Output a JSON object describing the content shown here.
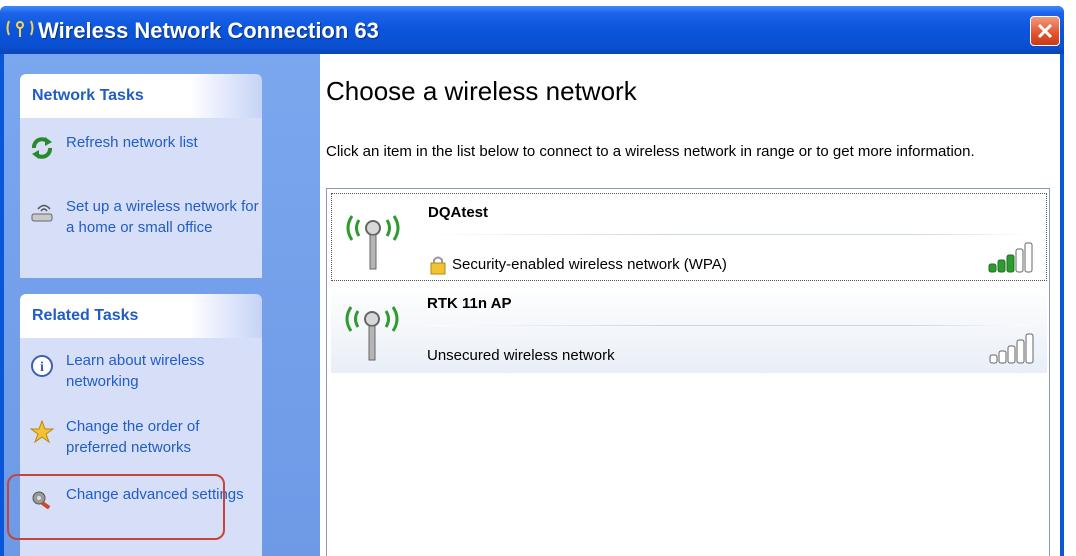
{
  "window": {
    "title": "Wireless Network Connection 63"
  },
  "left_pane": {
    "network_tasks": {
      "header": "Network Tasks",
      "items": [
        {
          "label": "Refresh network list",
          "icon": "refresh-icon"
        },
        {
          "label": "Set up a wireless network for a home or small office",
          "icon": "wireless-setup-icon"
        }
      ]
    },
    "related_tasks": {
      "header": "Related Tasks",
      "items": [
        {
          "label": "Learn about wireless networking",
          "icon": "info-icon"
        },
        {
          "label": "Change the order of preferred networks",
          "icon": "star-icon"
        },
        {
          "label": "Change advanced settings",
          "icon": "settings-icon"
        }
      ]
    }
  },
  "main": {
    "heading": "Choose a wireless network",
    "instructions": "Click an item in the list below to connect to a wireless network in range or to get more information.",
    "networks": [
      {
        "ssid": "DQAtest",
        "status": "Security-enabled wireless network (WPA)",
        "secured": true,
        "signal_bars": 3,
        "selected": true
      },
      {
        "ssid": "RTK 11n AP",
        "status": "Unsecured wireless network",
        "secured": false,
        "signal_bars": 0,
        "selected": false
      }
    ]
  },
  "colors": {
    "title_bar": "#0b55dc",
    "task_link": "#215dc6",
    "task_body": "#d6dff7",
    "signal_on": "#2e9b2e",
    "highlight_outline": "#c6453a"
  }
}
